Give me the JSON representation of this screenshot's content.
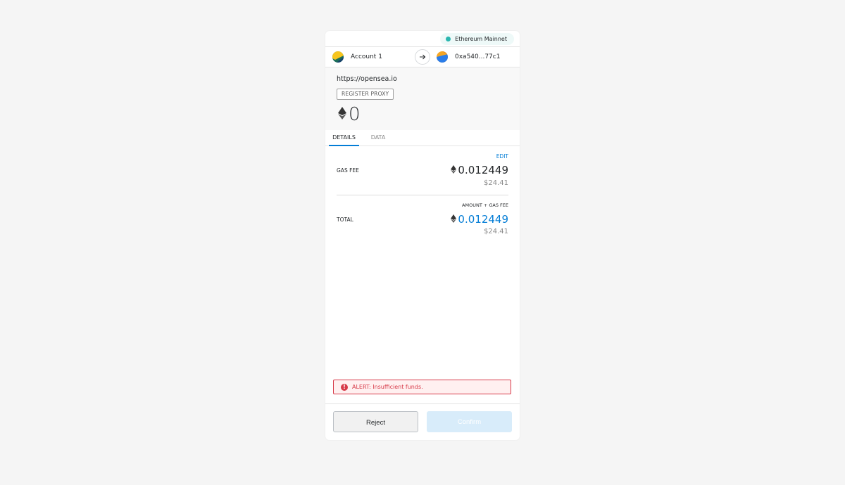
{
  "network": {
    "name": "Ethereum Mainnet",
    "dot_color": "#29b6af"
  },
  "accounts": {
    "from_name": "Account 1",
    "from_icon": "identicon-icon",
    "arrow_icon": "arrow-right-icon",
    "to_address": "0xa540...77c1",
    "to_icon": "identicon-icon"
  },
  "summary": {
    "origin": "https://opensea.io",
    "method": "REGISTER PROXY",
    "currency_icon": "eth-icon",
    "amount": "0"
  },
  "tabs": [
    {
      "label": "DETAILS",
      "active": true
    },
    {
      "label": "DATA",
      "active": false
    }
  ],
  "details": {
    "edit_label": "EDIT",
    "gas_fee_label": "GAS FEE",
    "gas_fee_eth": "0.012449",
    "gas_fee_fiat": "$24.41",
    "total_subheader": "AMOUNT + GAS FEE",
    "total_label": "TOTAL",
    "total_eth": "0.012449",
    "total_fiat": "$24.41"
  },
  "alert": {
    "icon": "alert-icon",
    "text": "ALERT: Insufficient funds.",
    "color": "#d73a49"
  },
  "footer": {
    "reject_label": "Reject",
    "confirm_label": "Confirm"
  },
  "colors": {
    "accent": "#037dd6",
    "background": "#f5f5f5"
  }
}
